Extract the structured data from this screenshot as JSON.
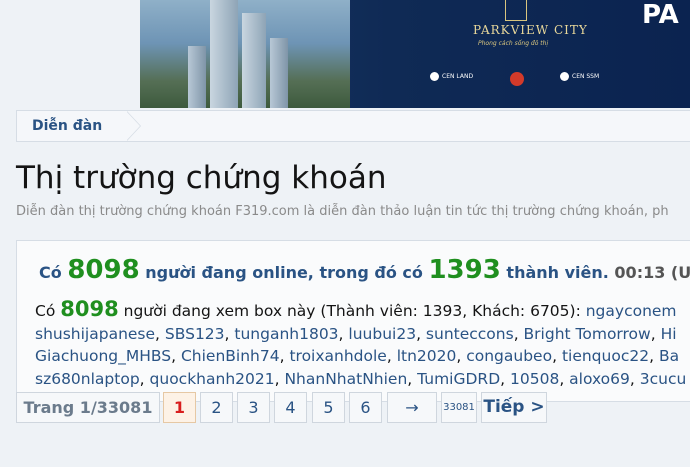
{
  "banner": {
    "brand": "PARKVIEW CITY",
    "tagline": "Phong cách sống đô thị",
    "partners": [
      "CEN LAND",
      "CEN SSM"
    ],
    "edge_letter": "PA"
  },
  "breadcrumb": {
    "label": "Diễn đàn"
  },
  "page": {
    "title": "Thị trường chứng khoán",
    "description": "Diễn đàn thị trường chứng khoán F319.com là diễn đàn thảo luận tin tức thị trường chứng khoán, ph"
  },
  "online": {
    "prefix": "Có",
    "online_count": "8098",
    "mid_text": "người đang online, trong đó có",
    "member_count": "1393",
    "suffix": "thành viên.",
    "time": "00:13 (UT",
    "viewers_prefix": "Có",
    "viewers_count": "8098",
    "viewers_text": "người đang xem box này (Thành viên: 1393, Khách: 6705):",
    "lines": [
      [
        "ngayconem"
      ],
      [
        "shushijapanese",
        "SBS123",
        "tunganh1803",
        "luubui23",
        "sunteccons",
        "Bright Tomorrow",
        "Hi"
      ],
      [
        "Giachuong_MHBS",
        "ChienBinh74",
        "troixanhdole",
        "ltn2020",
        "congaubeo",
        "tienquoc22",
        "Ba"
      ],
      [
        "sz680nlaptop",
        "quockhanh2021",
        "NhanNhatNhien",
        "TumiGDRD",
        "10508",
        "aloxo69",
        "3cucu"
      ]
    ]
  },
  "pagination": {
    "label": "Trang 1/33081",
    "pages": [
      "1",
      "2",
      "3",
      "4",
      "5",
      "6"
    ],
    "ellipsis_arrow": "→",
    "last": "33081",
    "next": "Tiếp >"
  }
}
